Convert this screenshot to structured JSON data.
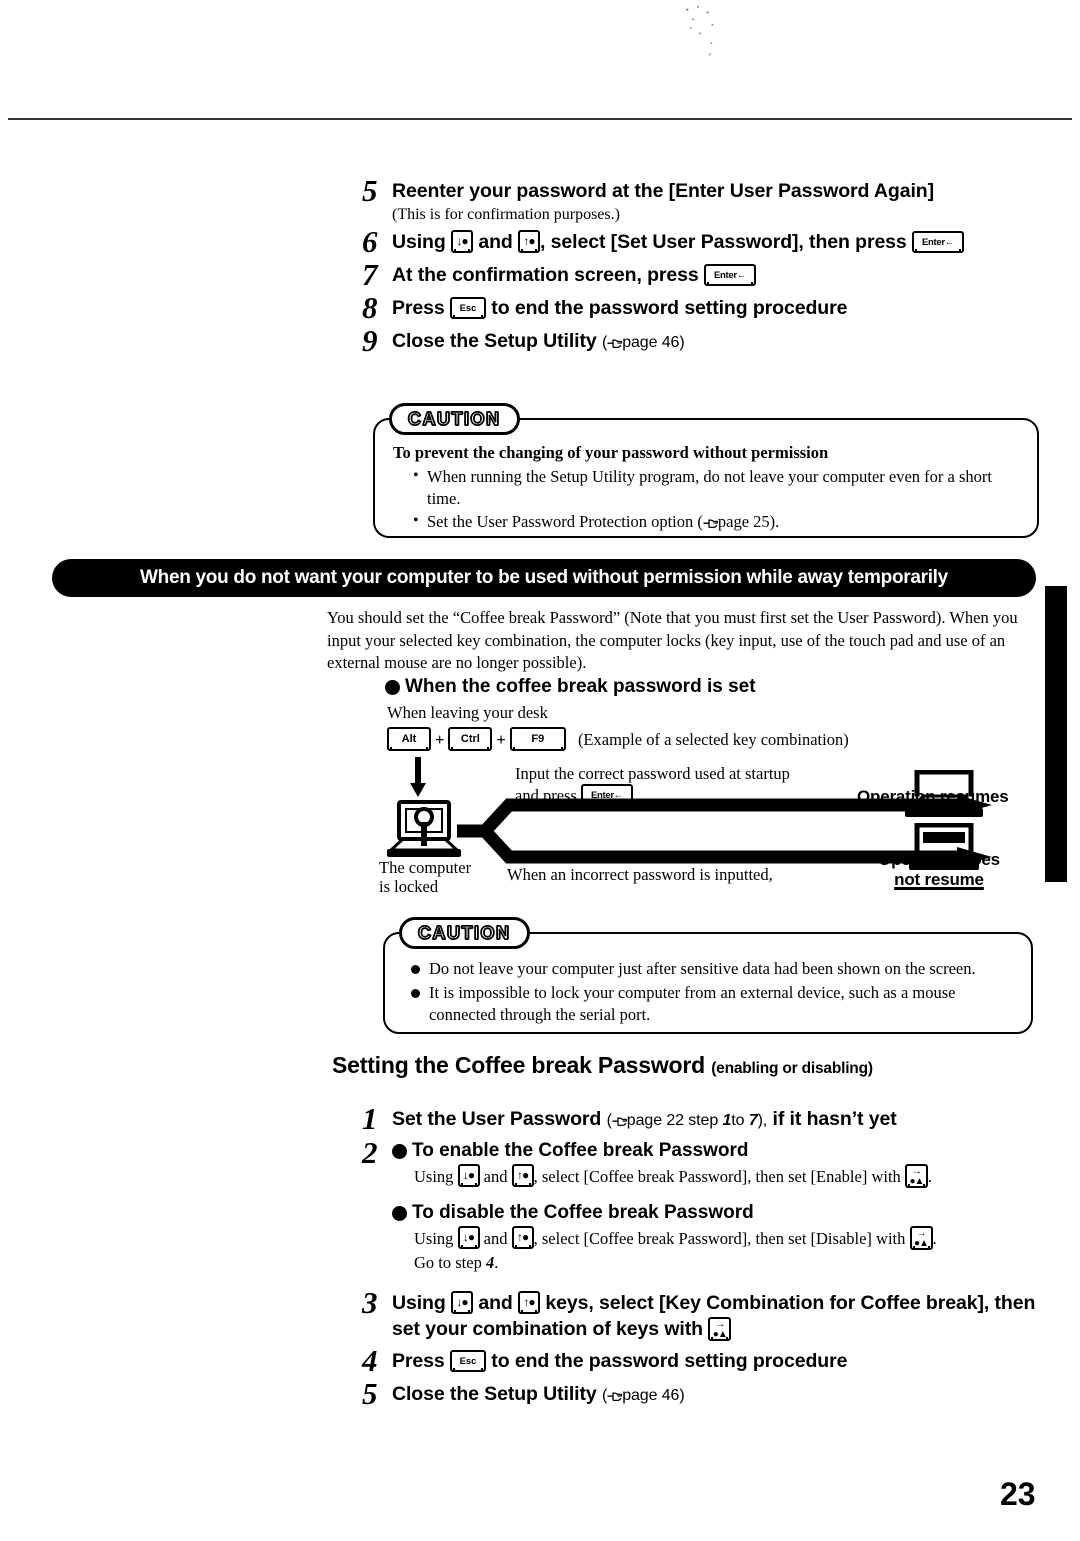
{
  "page_number": "23",
  "steps_top": [
    {
      "num": "5",
      "heading": "Reenter your password at the [Enter User Password Again]",
      "sub": "(This is for confirmation purposes.)"
    },
    {
      "num": "6",
      "heading_a": "Using",
      "heading_b": "and",
      "heading_c": ", select [Set User Password], then press"
    },
    {
      "num": "7",
      "heading_a": "At the confirmation screen, press"
    },
    {
      "num": "8",
      "heading_a": "Press",
      "heading_b": "to end the password setting procedure"
    },
    {
      "num": "9",
      "heading_a": "Close the Setup Utility",
      "ref_open": "(",
      "ref_text": "page 46",
      "ref_close": ")"
    }
  ],
  "caution_1": {
    "badge": "CAUTION",
    "title": "To prevent the changing of your password without permission",
    "items": [
      "When running the Setup Utility program, do not leave your computer even for a short time.",
      "Set the User Password Protection option ("
    ],
    "item2_ref": "page 25",
    "item2_tail": ")."
  },
  "banner": "When you do not want your computer to be used without permission while away temporarily",
  "intro": "You should set the “Coffee break Password” (Note that you must first set the User Password). When you input your selected key combination, the computer locks (key input, use of the touch pad and use of an external mouse are no longer possible).",
  "bullet_heading_set": "When the coffee break password is set",
  "diagram": {
    "leaving_desk": "When leaving your desk",
    "key_alt": "Alt",
    "key_ctrl": "Ctrl",
    "key_f9": "F9",
    "key_example_note": "(Example of a selected key combination)",
    "input_line1": "Input the correct password used at startup",
    "input_line2_a": "and press",
    "input_line2_b": ".",
    "computer_locked_line1": "The computer",
    "computer_locked_line2": "is locked",
    "incorrect_password": "When an incorrect password is inputted,",
    "operation_resumes": "Operation resumes",
    "operation_not_resume_line1": "Operation does",
    "operation_not_resume_line2": "not resume"
  },
  "caution_2": {
    "badge": "CAUTION",
    "items": [
      "Do not leave your computer just after sensitive data had been shown on the screen.",
      "It is impossible to lock your computer from an external device, such as a mouse connected through the serial port."
    ]
  },
  "section_heading": {
    "main": "Setting the Coffee break Password",
    "sub": "(enabling or disabling)"
  },
  "steps_bottom": [
    {
      "num": "1",
      "head_a": "Set the User Password",
      "ref_open": "(",
      "ref_text": "page 22 step",
      "ref_step_from": "1",
      "ref_to": "to",
      "ref_step_to": "7",
      "ref_close": "),",
      "head_b": "if it hasn’t yet"
    },
    {
      "num": "2",
      "enable_heading": "To enable the Coffee break Password",
      "enable_a": "Using",
      "enable_b": "and",
      "enable_c": ", select [Coffee break Password], then set [Enable] with",
      "enable_d": ".",
      "disable_heading": "To disable the Coffee break Password",
      "disable_a": "Using",
      "disable_b": "and",
      "disable_c": ", select [Coffee break Password], then set [Disable] with",
      "disable_d": ".",
      "goto_a": "Go to step",
      "goto_b": "4",
      "goto_c": "."
    },
    {
      "num": "3",
      "head_a": "Using",
      "head_b": "and",
      "head_c": "keys, select [Key Combination for Coffee break], then set your combination of keys with"
    },
    {
      "num": "4",
      "head_a": "Press",
      "head_b": "to end the password setting procedure"
    },
    {
      "num": "5",
      "head_a": "Close the Setup Utility",
      "ref_open": "(",
      "ref_text": "page 46",
      "ref_close": ")"
    }
  ],
  "icons": {
    "key_down": "arrow-down-key-icon",
    "key_up": "arrow-up-key-icon",
    "key_enter": "enter-key-icon",
    "key_esc": "esc-key-icon",
    "key_tab": "tab-key-icon",
    "hand": "hand-pointer-icon"
  },
  "key_labels": {
    "enter": "Enter",
    "esc": "Esc"
  },
  "colors": {
    "ink": "#000000",
    "paper": "#ffffff"
  }
}
